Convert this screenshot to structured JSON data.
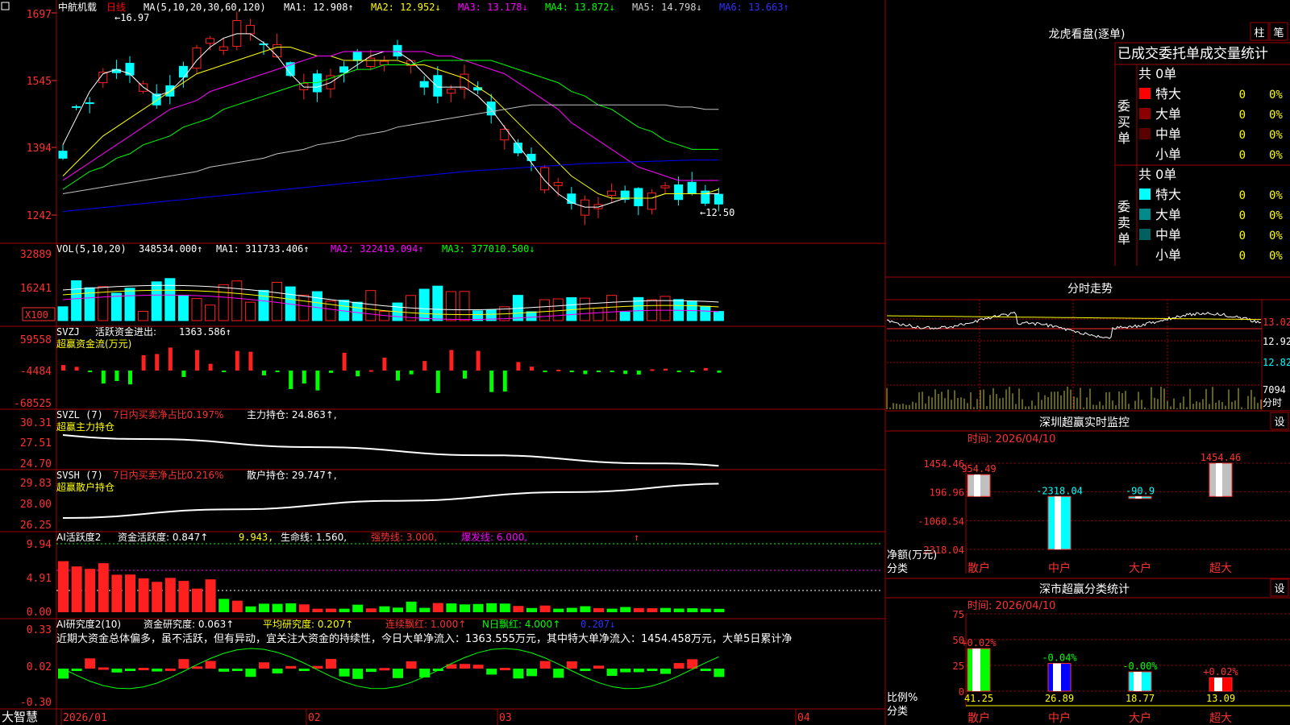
{
  "stock_name": "中航机载",
  "period_label": "日线",
  "brand": "大智慧",
  "colors": {
    "up": "#ff2020",
    "down": "#00ffff",
    "grid": "#a00000",
    "ma1": "#ffffff",
    "ma2": "#ffff00",
    "ma3": "#ff00ff",
    "ma4": "#00ff00",
    "ma5": "#c0c0c0",
    "ma6": "#0000ff"
  },
  "main_panel": {
    "header": {
      "ma_params": "MA(5,10,20,30,60,120)",
      "ma1": "MA1: 12.908↑",
      "ma2": "MA2: 12.952↓",
      "ma3": "MA3: 13.178↓",
      "ma4": "MA4: 13.872↓",
      "ma5": "MA5: 14.798↓",
      "ma6": "MA6: 13.663↑"
    },
    "y_ticks": [
      "1697",
      "1545",
      "1394",
      "1242"
    ],
    "high_label": "←16.97",
    "low_label": "←12.50"
  },
  "vol_panel": {
    "header": {
      "name": "VOL(5,10,20)",
      "value": "348534.000↑",
      "ma1": "MA1: 311733.406↑",
      "ma2": "MA2: 322419.094↑",
      "ma3": "MA3: 377010.500↓"
    },
    "y_ticks": [
      "32889",
      "16241"
    ],
    "unit": "X100"
  },
  "svzj_panel": {
    "header": {
      "name": "SVZJ",
      "title": "活跃资金进出:",
      "value": "1363.586↑",
      "subtitle": "超赢资金流(万元)"
    },
    "y_ticks": [
      "59558",
      "-4484",
      "-68525"
    ]
  },
  "svzl_panel": {
    "header": {
      "name": "SVZL (7)",
      "ratio": "7日内买卖净占比0.197%",
      "hold": "主力持仓: 24.863↑,",
      "subtitle": "超赢主力持仓"
    },
    "y_ticks": [
      "30.31",
      "27.51",
      "24.70"
    ]
  },
  "svsh_panel": {
    "header": {
      "name": "SVSH (7)",
      "ratio": "7日内买卖净占比0.216%",
      "hold": "散户持仓: 29.747↑,",
      "subtitle": "超赢散户持仓"
    },
    "y_ticks": [
      "29.83",
      "28.00",
      "26.25"
    ]
  },
  "ai_active_panel": {
    "header": {
      "name": "AI活跃度2",
      "active": "资金活跃度: 0.847↑",
      "v2": "9.943,",
      "life": "生命线: 1.560,",
      "strong": "强势线: 3.000,",
      "burst": "爆发线: 6.000,",
      "arrow": "↑"
    },
    "y_ticks": [
      "9.94",
      "4.91",
      "0.00"
    ]
  },
  "ai_research_panel": {
    "header": {
      "name": "AI研究度2(10)",
      "research": "资金研究度: 0.063↑",
      "avg": "平均研究度: 0.207↑",
      "red": "连续飘红: 1.000↑",
      "nred": "N日飘红: 4.000↑",
      "v": "0.207↓"
    },
    "comment": "近期大资金总体偏多，虽不活跃，但有异动，宜关注大资金的持续性，今日大单净流入：1363.555万元，其中特大单净流入：1454.458万元，大单5日累计净",
    "y_ticks": [
      "0.33",
      "0.02",
      "-0.30"
    ]
  },
  "date_axis": [
    "2026/01",
    "02",
    "03",
    "04"
  ],
  "right_panel": {
    "longhu": {
      "title": "龙虎看盘(逐单)",
      "btn_bar": "柱",
      "btn_pen": "笔",
      "headline": "已成交委托单成交量统计",
      "buy": {
        "label_chars": [
          "委",
          "买",
          "单"
        ],
        "total": "共 0单",
        "rows": [
          {
            "name": "特大",
            "count": "0",
            "pct": "0%",
            "color": "#ff0000"
          },
          {
            "name": "大单",
            "count": "0",
            "pct": "0%",
            "color": "#8b0000"
          },
          {
            "name": "中单",
            "count": "0",
            "pct": "0%",
            "color": "#5a0000"
          },
          {
            "name": "小单",
            "count": "0",
            "pct": "0%",
            "color": "#000000"
          }
        ]
      },
      "sell": {
        "label_chars": [
          "委",
          "卖",
          "单"
        ],
        "total": "共 0单",
        "rows": [
          {
            "name": "特大",
            "count": "0",
            "pct": "0%",
            "color": "#00ffff"
          },
          {
            "name": "大单",
            "count": "0",
            "pct": "0%",
            "color": "#008b8b"
          },
          {
            "name": "中单",
            "count": "0",
            "pct": "0%",
            "color": "#006060"
          },
          {
            "name": "小单",
            "count": "0",
            "pct": "0%",
            "color": "#000000"
          }
        ]
      }
    },
    "intraday": {
      "title": "分时走势",
      "price_ticks": [
        "13.02",
        "12.92",
        "12.82"
      ],
      "vol_tick": "7094",
      "vol_unit": "分时"
    },
    "realtime": {
      "title": "深圳超赢实时监控",
      "btn": "设",
      "time": "时间: 2026/04/10",
      "y_ticks": [
        "1454.46",
        "196.96",
        "-1060.54",
        "-2318.04"
      ],
      "unit_label": "净额(万元)",
      "cat_label": "分类",
      "bars": [
        {
          "cat": "散户",
          "value": 954.49,
          "label": "954.49"
        },
        {
          "cat": "中户",
          "value": -2318.04,
          "label": "-2318.04"
        },
        {
          "cat": "大户",
          "value": -90.9,
          "label": "-90.9"
        },
        {
          "cat": "超大",
          "value": 1454.46,
          "label": "1454.46"
        }
      ]
    },
    "classify": {
      "title": "深市超赢分类统计",
      "btn": "设",
      "time": "时间: 2026/04/10",
      "y_ticks": [
        "75",
        "50",
        "25",
        "0"
      ],
      "unit_label": "比例%",
      "cat_label": "分类",
      "bars": [
        {
          "cat": "散户",
          "value": 41.25,
          "change": "+0.02%",
          "color": "#00ff00"
        },
        {
          "cat": "中户",
          "value": 26.89,
          "change": "-0.04%",
          "color": "#0000ff"
        },
        {
          "cat": "大户",
          "value": 18.77,
          "change": "-0.00%",
          "color": "#00ffff"
        },
        {
          "cat": "超大",
          "value": 13.09,
          "change": "+0.02%",
          "color": "#ff0000"
        }
      ]
    }
  },
  "chart_data": [
    {
      "type": "line",
      "title": "中航机载 日线",
      "y_axis_ticks": [
        16.97,
        15.45,
        13.94,
        12.42
      ],
      "series": [
        {
          "name": "MA1",
          "values": [
            14.0,
            14.6,
            15.2,
            15.6,
            15.7,
            15.6,
            15.3,
            15.1,
            15.2,
            15.5,
            15.9,
            16.2,
            16.4,
            16.5,
            16.5,
            16.3,
            16.0,
            15.6,
            15.3,
            15.3,
            15.4,
            15.6,
            15.8,
            16.0,
            16.1,
            16.1,
            15.9,
            15.6,
            15.3,
            15.3,
            15.3,
            15.1,
            14.8,
            14.4,
            14.0,
            13.6,
            13.2,
            12.9,
            12.7,
            12.6,
            12.6,
            12.7,
            12.8,
            12.8,
            12.8,
            12.9,
            12.9,
            12.9,
            12.9,
            12.9
          ]
        },
        {
          "name": "MA2",
          "values": [
            13.3,
            13.6,
            13.9,
            14.2,
            14.4,
            14.6,
            14.8,
            15.0,
            15.2,
            15.4,
            15.6,
            15.7,
            15.8,
            15.9,
            16.0,
            16.1,
            16.2,
            16.2,
            16.1,
            16.0,
            16.0,
            15.9,
            15.9,
            15.9,
            15.9,
            15.9,
            15.8,
            15.8,
            15.7,
            15.6,
            15.5,
            15.3,
            15.1,
            14.8,
            14.5,
            14.2,
            13.9,
            13.6,
            13.3,
            13.1,
            12.9,
            12.8,
            12.8,
            12.8,
            12.8,
            12.9,
            12.9,
            12.9,
            12.9,
            13.0
          ]
        },
        {
          "name": "MA3",
          "values": [
            13.2,
            13.4,
            13.6,
            13.8,
            14.0,
            14.2,
            14.4,
            14.6,
            14.8,
            14.9,
            15.0,
            15.2,
            15.3,
            15.4,
            15.5,
            15.6,
            15.7,
            15.8,
            15.9,
            16.0,
            16.0,
            16.1,
            16.1,
            16.1,
            16.1,
            16.1,
            16.1,
            16.1,
            16.0,
            16.0,
            15.9,
            15.8,
            15.7,
            15.6,
            15.4,
            15.2,
            15.0,
            14.8,
            14.5,
            14.3,
            14.1,
            13.9,
            13.7,
            13.5,
            13.4,
            13.3,
            13.2,
            13.2,
            13.2,
            13.2
          ]
        },
        {
          "name": "MA4",
          "values": [
            13.0,
            13.2,
            13.4,
            13.5,
            13.7,
            13.8,
            14.0,
            14.1,
            14.2,
            14.4,
            14.5,
            14.6,
            14.8,
            14.9,
            15.0,
            15.1,
            15.2,
            15.3,
            15.4,
            15.4,
            15.5,
            15.6,
            15.7,
            15.7,
            15.8,
            15.8,
            15.8,
            15.9,
            15.9,
            15.9,
            15.9,
            15.9,
            15.9,
            15.8,
            15.7,
            15.6,
            15.5,
            15.4,
            15.2,
            15.1,
            14.9,
            14.8,
            14.6,
            14.4,
            14.3,
            14.1,
            14.0,
            13.9,
            13.9,
            13.9
          ]
        },
        {
          "name": "MA5",
          "values": [
            12.9,
            12.95,
            13.0,
            13.05,
            13.1,
            13.15,
            13.2,
            13.25,
            13.3,
            13.35,
            13.4,
            13.5,
            13.55,
            13.6,
            13.65,
            13.7,
            13.8,
            13.85,
            13.9,
            14.0,
            14.05,
            14.1,
            14.2,
            14.25,
            14.3,
            14.4,
            14.45,
            14.5,
            14.55,
            14.6,
            14.65,
            14.7,
            14.75,
            14.8,
            14.85,
            14.9,
            14.9,
            14.9,
            14.9,
            14.9,
            14.9,
            14.9,
            14.9,
            14.9,
            14.9,
            14.9,
            14.85,
            14.85,
            14.8,
            14.8
          ]
        },
        {
          "name": "MA6",
          "values": [
            12.5,
            12.53,
            12.56,
            12.59,
            12.62,
            12.65,
            12.68,
            12.71,
            12.74,
            12.77,
            12.8,
            12.83,
            12.86,
            12.89,
            12.92,
            12.95,
            12.98,
            13.01,
            13.04,
            13.07,
            13.1,
            13.13,
            13.16,
            13.19,
            13.22,
            13.25,
            13.28,
            13.31,
            13.34,
            13.37,
            13.4,
            13.42,
            13.44,
            13.46,
            13.48,
            13.5,
            13.52,
            13.54,
            13.56,
            13.58,
            13.59,
            13.6,
            13.61,
            13.62,
            13.63,
            13.64,
            13.65,
            13.66,
            13.66,
            13.66
          ]
        }
      ]
    },
    {
      "type": "bar",
      "title": "深圳超赢实时监控",
      "categories": [
        "散户",
        "中户",
        "大户",
        "超大"
      ],
      "values": [
        954.49,
        -2318.04,
        -90.9,
        1454.46
      ]
    },
    {
      "type": "bar",
      "title": "深市超赢分类统计",
      "categories": [
        "散户",
        "中户",
        "大户",
        "超大"
      ],
      "values": [
        41.25,
        26.89,
        18.77,
        13.09
      ]
    }
  ]
}
